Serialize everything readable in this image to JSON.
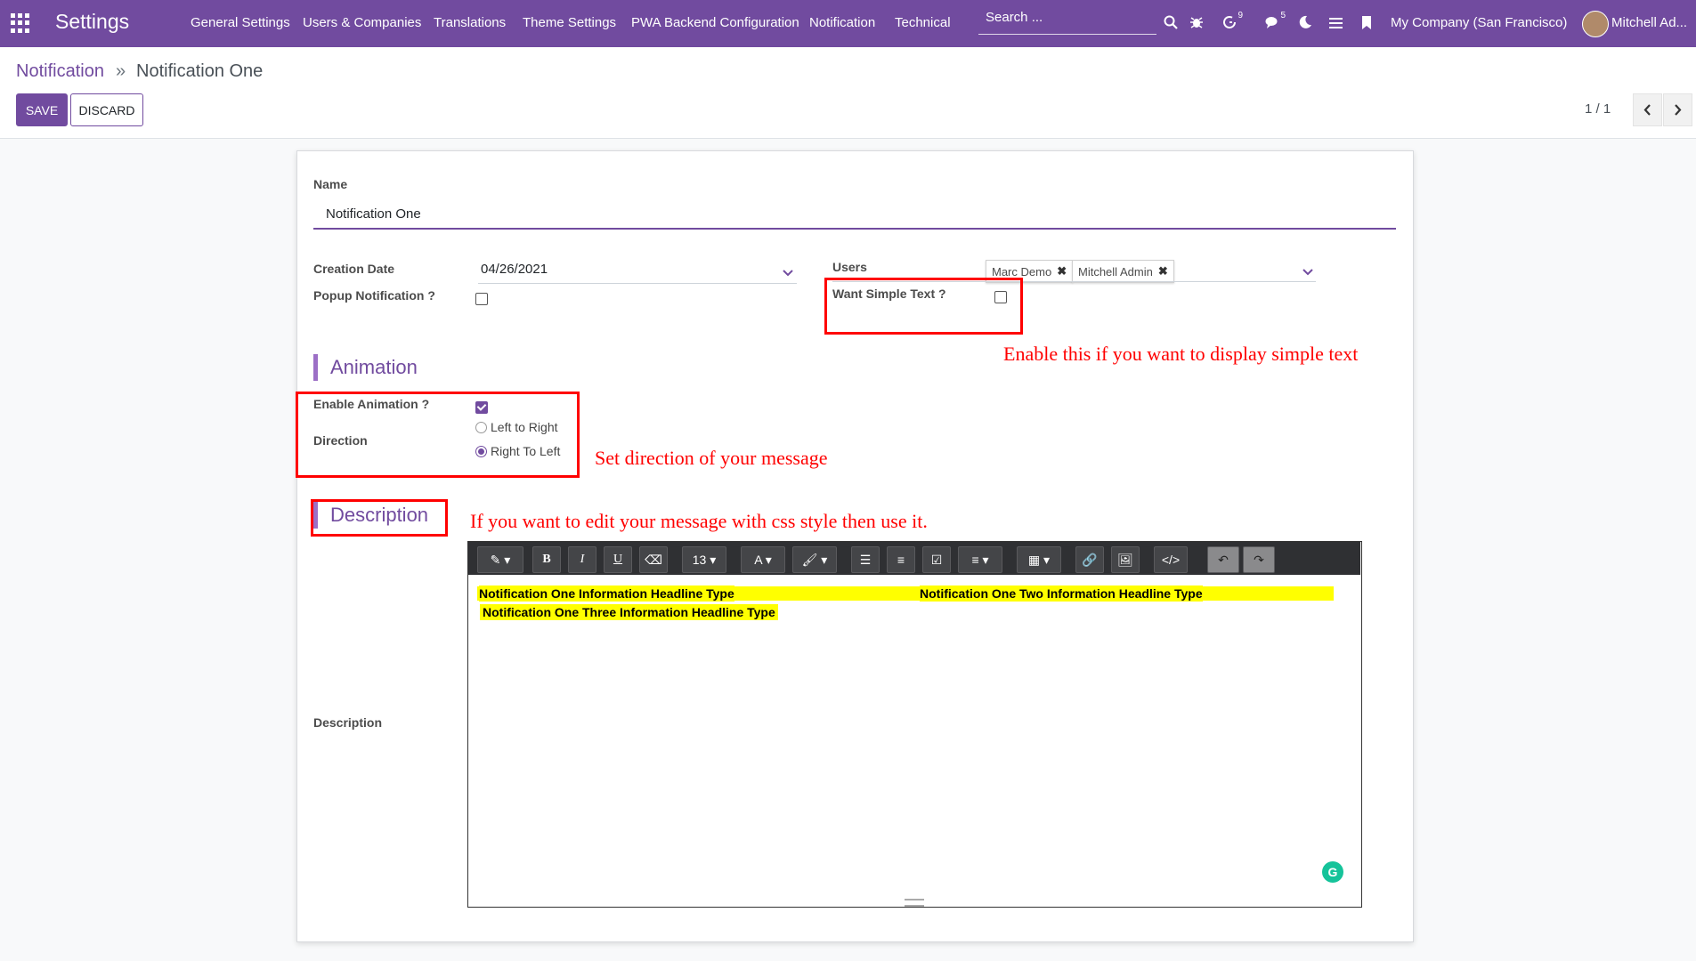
{
  "navbar": {
    "brand": "Settings",
    "menu": [
      "General Settings",
      "Users & Companies",
      "Translations",
      "Theme Settings",
      "PWA Backend Configuration",
      "Notification",
      "Technical"
    ],
    "search_placeholder": "Search ...",
    "activity_count": "9",
    "messages_count": "5",
    "company": "My Company (San Francisco)",
    "user": "Mitchell Ad..."
  },
  "breadcrumb": {
    "parent": "Notification",
    "separator": "»",
    "current": "Notification One"
  },
  "actions": {
    "save": "SAVE",
    "discard": "DISCARD"
  },
  "pager": {
    "value": "1 / 1"
  },
  "form": {
    "name_label": "Name",
    "name_value": "Notification One",
    "creation_date_label": "Creation Date",
    "creation_date_value": "04/26/2021",
    "popup_label": "Popup Notification ?",
    "popup_checked": false,
    "users_label": "Users",
    "users": [
      "Marc Demo",
      "Mitchell Admin"
    ],
    "simple_text_label": "Want Simple Text ?",
    "simple_text_checked": false,
    "animation_title": "Animation",
    "enable_animation_label": "Enable Animation ?",
    "enable_animation_checked": true,
    "direction_label": "Direction",
    "direction_options": [
      "Left to Right",
      "Right To Left"
    ],
    "direction_selected": "Right To Left",
    "description_title": "Description",
    "description_label": "Description"
  },
  "editor": {
    "font_size": "13",
    "content": [
      "Notification One  Information Headline Type",
      "Notification One  Two Information Headline Type",
      "Notification One  Three  Information Headline Type"
    ]
  },
  "annotations": {
    "simple_text": "Enable this if you want to display simple text",
    "direction": "Set direction of your message",
    "description": "If you want to edit your message with css style then use it."
  },
  "colors": {
    "primary": "#714B9F",
    "annotation": "#ff0000",
    "highlight": "#ffff00"
  }
}
